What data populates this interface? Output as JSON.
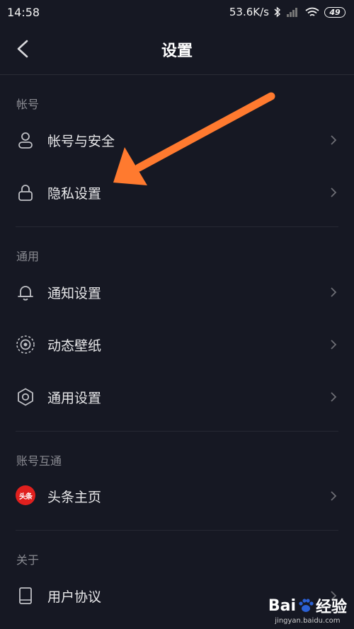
{
  "status_bar": {
    "time": "14:58",
    "network_speed": "53.6K/s",
    "battery": "49",
    "icons": [
      "bluetooth-icon",
      "signal-icon",
      "wifi-icon",
      "battery-icon"
    ]
  },
  "header": {
    "title": "设置",
    "back_icon": "chevron-left-icon"
  },
  "sections": {
    "account": {
      "label": "帐号",
      "items": [
        {
          "label": "帐号与安全",
          "icon": "user-icon"
        },
        {
          "label": "隐私设置",
          "icon": "lock-icon"
        }
      ]
    },
    "general": {
      "label": "通用",
      "items": [
        {
          "label": "通知设置",
          "icon": "bell-icon"
        },
        {
          "label": "动态壁纸",
          "icon": "live-wallpaper-icon"
        },
        {
          "label": "通用设置",
          "icon": "gear-icon"
        }
      ]
    },
    "interop": {
      "label": "账号互通",
      "items": [
        {
          "label": "头条主页",
          "icon": "toutiao-logo-icon",
          "badge_text": "头条"
        }
      ]
    },
    "about": {
      "label": "关于",
      "items": [
        {
          "label": "用户协议",
          "icon": "book-icon"
        }
      ]
    }
  },
  "annotation": {
    "arrow_color": "#ff7a2f"
  },
  "watermark": {
    "brand_left": "Bai",
    "brand_right": "经验",
    "url": "jingyan.baidu.com"
  },
  "colors": {
    "background": "#161823",
    "text": "#e8e8ea",
    "muted": "#8a8b92",
    "divider": "#262833"
  }
}
